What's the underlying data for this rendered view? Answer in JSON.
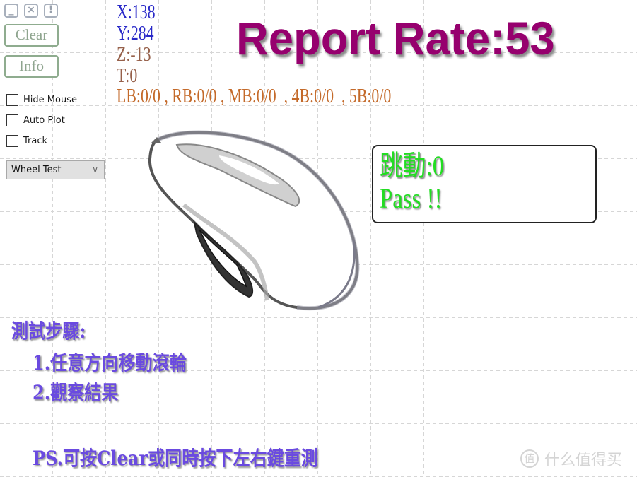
{
  "window_controls": {
    "minimize": "_",
    "close": "×",
    "alert": "!"
  },
  "buttons": {
    "clear_label": "Clear",
    "info_label": "Info"
  },
  "options": [
    {
      "label": "Hide Mouse",
      "checked": false
    },
    {
      "label": "Auto Plot",
      "checked": false
    },
    {
      "label": "Track",
      "checked": false
    }
  ],
  "mode_select": {
    "selected": "Wheel Test",
    "chevron": "∨"
  },
  "readout": {
    "x": "X:138",
    "y": "Y:284",
    "z": "Z:-13",
    "t": "T:0",
    "buttons_line": "LB:0/0 , RB:0/0 , MB:0/0  , 4B:0/0  , 5B:0/0"
  },
  "report_rate": "Report Rate:53",
  "result": {
    "jitter": "跳動:0",
    "status": "Pass !!"
  },
  "instructions": {
    "title": "測試步驟:",
    "step1": "1.任意方向移動滾輪",
    "step2": "2.觀察結果",
    "note": "PS.可按Clear或同時按下左右鍵重測"
  },
  "watermark": {
    "logo": "值",
    "text": "什么值得买"
  },
  "colors": {
    "rate": "#96006e",
    "pass": "#22dd22",
    "instructions": "#6a4ae0",
    "xy": "#2828c8",
    "zt": "#96604a",
    "buttons_line": "#c46a2a"
  }
}
